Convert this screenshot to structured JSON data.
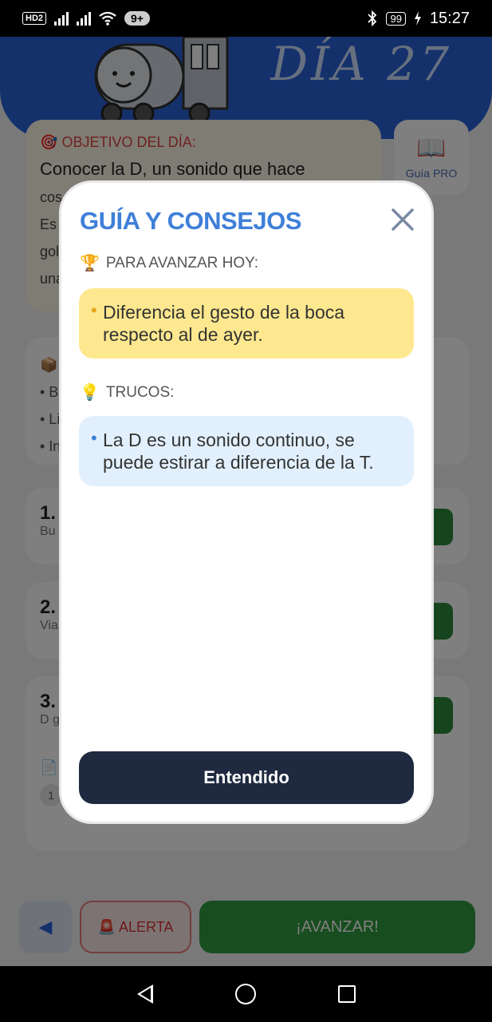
{
  "status_bar": {
    "hd_label": "HD",
    "hd_sub": "2",
    "notif_badge": "9+",
    "battery": "99",
    "time": "15:27"
  },
  "background": {
    "day_title": "DÍA 27",
    "goal": {
      "header": "OBJETIVO DEL DÍA:",
      "text": "Conocer la D, un sonido que hace",
      "partial_lines": [
        "cos",
        "Es",
        "gol",
        "una"
      ]
    },
    "pro_card": {
      "label": "Guía PRO"
    },
    "materials_partial": [
      "• B",
      "• Li",
      "• In"
    ],
    "steps": [
      {
        "num": "1.",
        "sub": "Bu"
      },
      {
        "num": "2.",
        "sub": "Via"
      },
      {
        "num": "3.",
        "sub": "D g"
      }
    ],
    "step3_counter": "1",
    "bottom": {
      "back": "◀",
      "alert": "ALERTA",
      "advance": "¡AVANZAR!"
    }
  },
  "modal": {
    "title": "GUÍA Y CONSEJOS",
    "section1_header": "PARA AVANZAR HOY:",
    "section1_item": "Diferencia el gesto de la boca respecto al de ayer.",
    "section2_header": "TRUCOS:",
    "section2_item": "La D es un sonido continuo, se puede estirar a diferencia de la T.",
    "ok_button": "Entendido"
  },
  "icons": {
    "trophy": "trophy-icon",
    "bulb": "lightbulb-icon",
    "close": "close-icon"
  },
  "colors": {
    "accent_blue": "#3f7fd8",
    "yellow_box": "#fde88f",
    "blue_box": "#e2f0fd",
    "dark_button": "#1f2a40",
    "advance_green": "#2f9a3f"
  }
}
